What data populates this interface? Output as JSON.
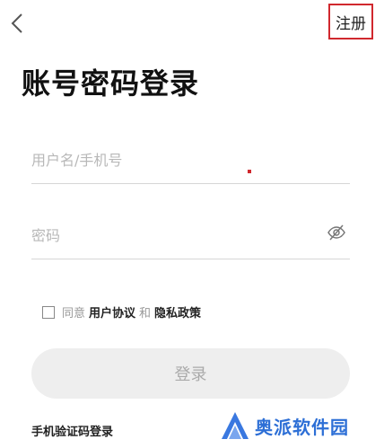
{
  "header": {
    "back_icon": "chevron-left-icon",
    "register_label": "注册",
    "highlight_color": "#d0282e"
  },
  "page_title": "账号密码登录",
  "form": {
    "username_placeholder": "用户名/手机号",
    "password_placeholder": "密码",
    "password_toggle_icon": "eye-off-icon"
  },
  "agreement": {
    "prefix": "同意",
    "user_agreement": "用户协议",
    "conjunction": "和",
    "privacy_policy": "隐私政策"
  },
  "login_button_label": "登录",
  "sms_login_label": "手机验证码登录",
  "watermark": {
    "logo_icon": "aopai-logo",
    "text": "奥派软件园"
  }
}
